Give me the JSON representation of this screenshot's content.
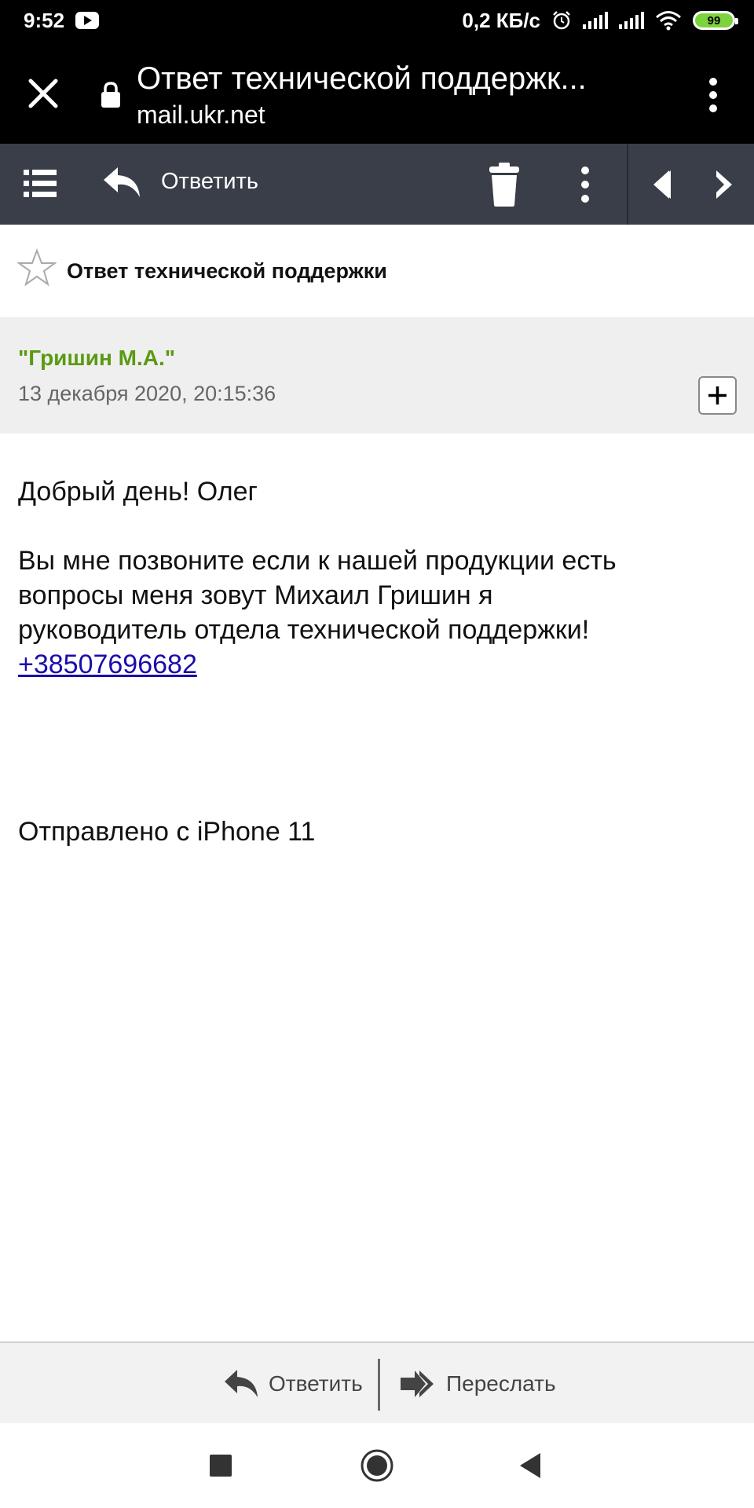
{
  "status_bar": {
    "time": "9:52",
    "network_speed": "0,2 КБ/с",
    "battery": "99",
    "icons": [
      "youtube-icon",
      "alarm-icon",
      "signal-icon",
      "wifi-icon",
      "battery-icon"
    ]
  },
  "browser": {
    "tab_title": "Ответ технической поддержк...",
    "url": "mail.ukr.net"
  },
  "toolbar": {
    "reply_label": "Ответить"
  },
  "message": {
    "subject": "Ответ технической поддержки",
    "sender": "\"Гришин М.А.\"",
    "date": "13 декабря 2020, 20:15:36",
    "greeting": "Добрый день! Олег",
    "body_lines": [
      "Вы мне позвоните если к нашей продукции есть",
      "вопросы меня зовут Михаил Гришин я",
      "руководитель отдела технической поддержки!"
    ],
    "phone": "+38507696682",
    "signature": "Отправлено с iPhone 11"
  },
  "footer": {
    "reply_label": "Ответить",
    "forward_label": "Переслать"
  },
  "colors": {
    "toolbar_bg": "#393e48",
    "sender_name": "#5a9a12",
    "link": "#1a0dab",
    "battery": "#7cd33d"
  }
}
